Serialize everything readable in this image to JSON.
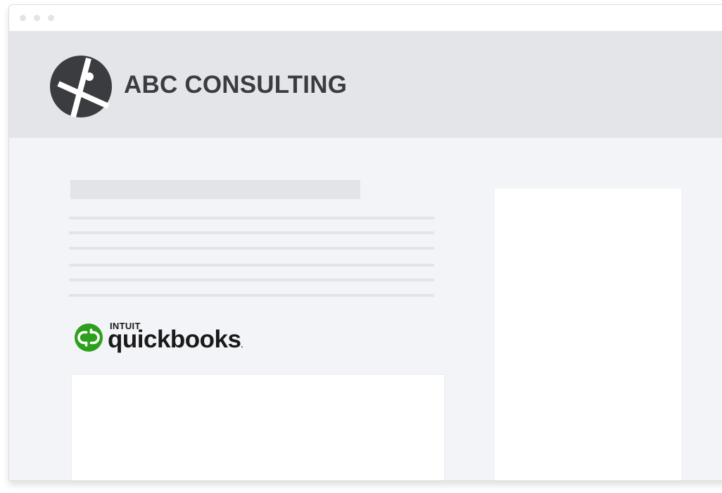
{
  "window": {
    "controls": [
      "window-dot",
      "window-dot",
      "window-dot"
    ]
  },
  "header": {
    "brand_name": "ABC CONSULTING",
    "logo_icon": "abc-consulting-logo-icon"
  },
  "content": {
    "integration_logo": {
      "intuit_text": "INTUIT",
      "product_text": "quickbooks",
      "icon": "quickbooks-qb-icon"
    }
  },
  "colors": {
    "header_bg": "#e4e5e8",
    "page_bg": "#f3f4f7",
    "brand_text": "#3b3c40",
    "quickbooks_green": "#2ca01c"
  }
}
